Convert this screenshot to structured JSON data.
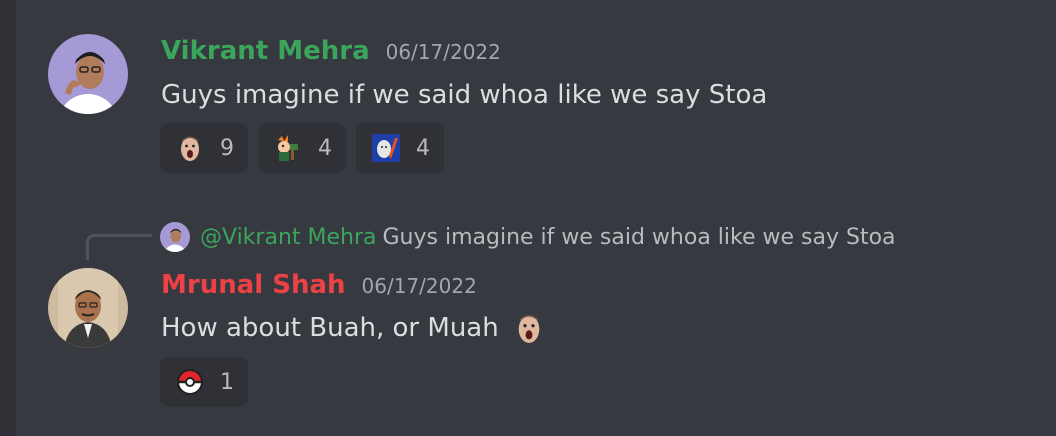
{
  "top_fragment": "",
  "messages": [
    {
      "author": "Vikrant Mehra",
      "author_color": "#3ba55c",
      "timestamp": "06/17/2022",
      "text": "Guys imagine if we said whoa like we say Stoa",
      "avatar_icon": "avatar-vikrant",
      "reactions": [
        {
          "emoji": "shocked-face-emoji",
          "count": "9"
        },
        {
          "emoji": "cartoon-emoji",
          "count": "4"
        },
        {
          "emoji": "meme-emoji",
          "count": "4"
        }
      ]
    },
    {
      "author": "Mrunal Shah",
      "author_color": "#ed4245",
      "timestamp": "06/17/2022",
      "text": "How about Buah, or Muah",
      "avatar_icon": "avatar-mrunal",
      "inline_emoji": "shocked-face-emoji",
      "reply_to": {
        "mention": "@Vikrant Mehra",
        "text": "Guys imagine if we said whoa like we say Stoa"
      },
      "reactions": [
        {
          "emoji": "pokeball-emoji",
          "count": "1"
        }
      ]
    }
  ]
}
